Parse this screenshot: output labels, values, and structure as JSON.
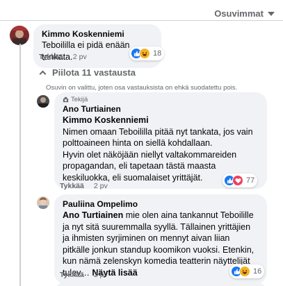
{
  "sort": {
    "label": "Osuvimmat"
  },
  "comments": [
    {
      "author": "Kimmo Koskenniemi",
      "text": "Teboililla ei pidä enään tankata.",
      "actions": {
        "like": "Tykkää",
        "time": "2 pv"
      },
      "reaction_count": "18",
      "reactions": [
        "like",
        "haha"
      ]
    }
  ],
  "replies_toggle": {
    "label": "Piilota 11 vastausta"
  },
  "filter_note": "Osuvin on valittu, joten osa vastauksista on ehkä suodatettu pois.",
  "replies": [
    {
      "badge": "Tekijä",
      "author": "Ano Turtiainen",
      "mention": "Kimmo Koskenniemi",
      "lines": [
        "Nimen omaan Teboililla pitää nyt tankata, jos vain polttoaineen hinta on siellä kohdallaan.",
        "Hyvin olet näköjään niellyt valtakommareiden propagandan, eli tapetaan tästä maasta keskiluokka, eli suomalaiset yrittäjät."
      ],
      "actions": {
        "like": "Tykkää",
        "time": "2 pv"
      },
      "reaction_count": "77",
      "reactions": [
        "like",
        "love"
      ]
    },
    {
      "author": "Pauliina Ompelimo",
      "mention": "Ano Turtiainen",
      "text": " mie olen aina tankannut Teboilille ja nyt sitä suuremmalla syyllä. Tällainen yrittäjien ja ihmisten syrjiminen on mennyt aivan liian pitkälle jonkun standup koomikon vuoksi. Etenkin, kun nämä zelenskyn komedia teatterin näyttelijät tulev…",
      "see_more": "Näytä lisää",
      "actions": {
        "like": "Tykkää",
        "time": "2 pv"
      },
      "reaction_count": "16",
      "reactions": [
        "like",
        "haha"
      ]
    }
  ],
  "colors": {
    "like": "#1877f2",
    "haha": "#f7b125",
    "love": "#f33e58",
    "muted": "#65676b",
    "bubble": "#f0f2f5"
  }
}
